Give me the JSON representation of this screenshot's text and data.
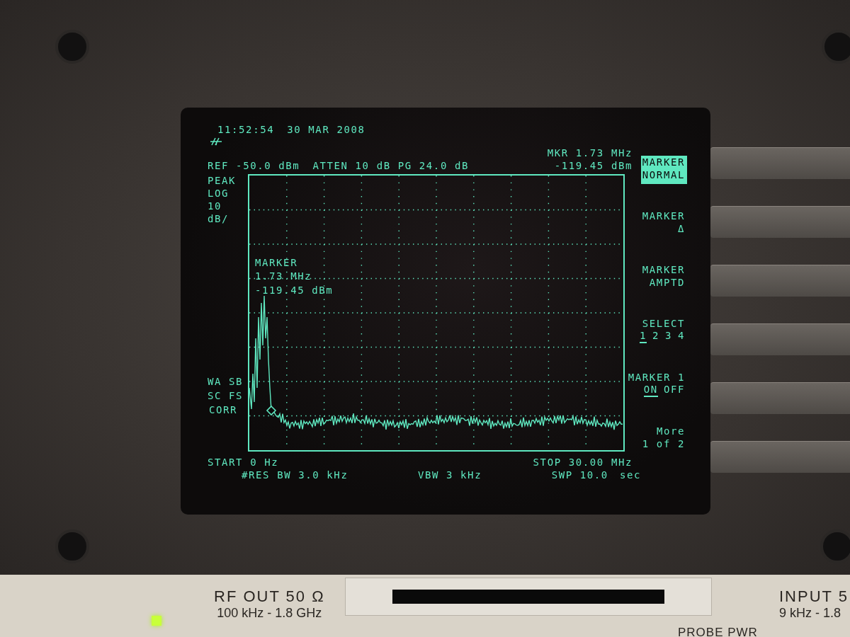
{
  "header": {
    "time": "11:52:54",
    "date": "30 MAR 2008",
    "ref": "REF -50.0 dBm",
    "atten": "ATTEN 10 dB",
    "pg": "PG 24.0 dB",
    "marker_freq": "MKR 1.73 MHz",
    "marker_level": "-119.45 dBm"
  },
  "left_labels": [
    "PEAK",
    "LOG",
    "10",
    "dB/"
  ],
  "status_labels": [
    "WA SB",
    "SC FS",
    "CORR"
  ],
  "marker_readout": [
    "MARKER",
    "1.73 MHz",
    "-119.45 dBm"
  ],
  "footer": {
    "start": "START 0 Hz",
    "stop": "STOP 30.00 MHz",
    "res_bw": "#RES BW 3.0 kHz",
    "vbw": "VBW 3 kHz",
    "swp": "SWP 10.0",
    "swp_unit": "sec"
  },
  "softkeys": [
    {
      "kind": "text",
      "lines": [
        "MARKER",
        "NORMAL"
      ],
      "selected": true
    },
    {
      "kind": "text",
      "lines": [
        "MARKER",
        "Δ"
      ],
      "selected": false
    },
    {
      "kind": "text",
      "lines": [
        "MARKER",
        "AMPTD"
      ],
      "selected": false
    },
    {
      "kind": "options",
      "title": "SELECT",
      "options": [
        {
          "label": "1",
          "selected": true
        },
        {
          "label": "2",
          "selected": false
        },
        {
          "label": "3",
          "selected": false
        },
        {
          "label": "4",
          "selected": false
        }
      ]
    },
    {
      "kind": "options",
      "title": "MARKER 1",
      "options": [
        {
          "label": "ON",
          "selected": true
        },
        {
          "label": "OFF",
          "selected": false
        }
      ]
    },
    {
      "kind": "text",
      "lines": [
        "More",
        "1 of 2"
      ],
      "selected": false
    }
  ],
  "panel": {
    "rf_out": "RF OUT 50 Ω",
    "rf_range": "100 kHz - 1.8 GHz",
    "input": "INPUT 5",
    "input_range": "9 kHz - 1.8",
    "probe": "PROBE PWR",
    "led_on": true
  }
}
